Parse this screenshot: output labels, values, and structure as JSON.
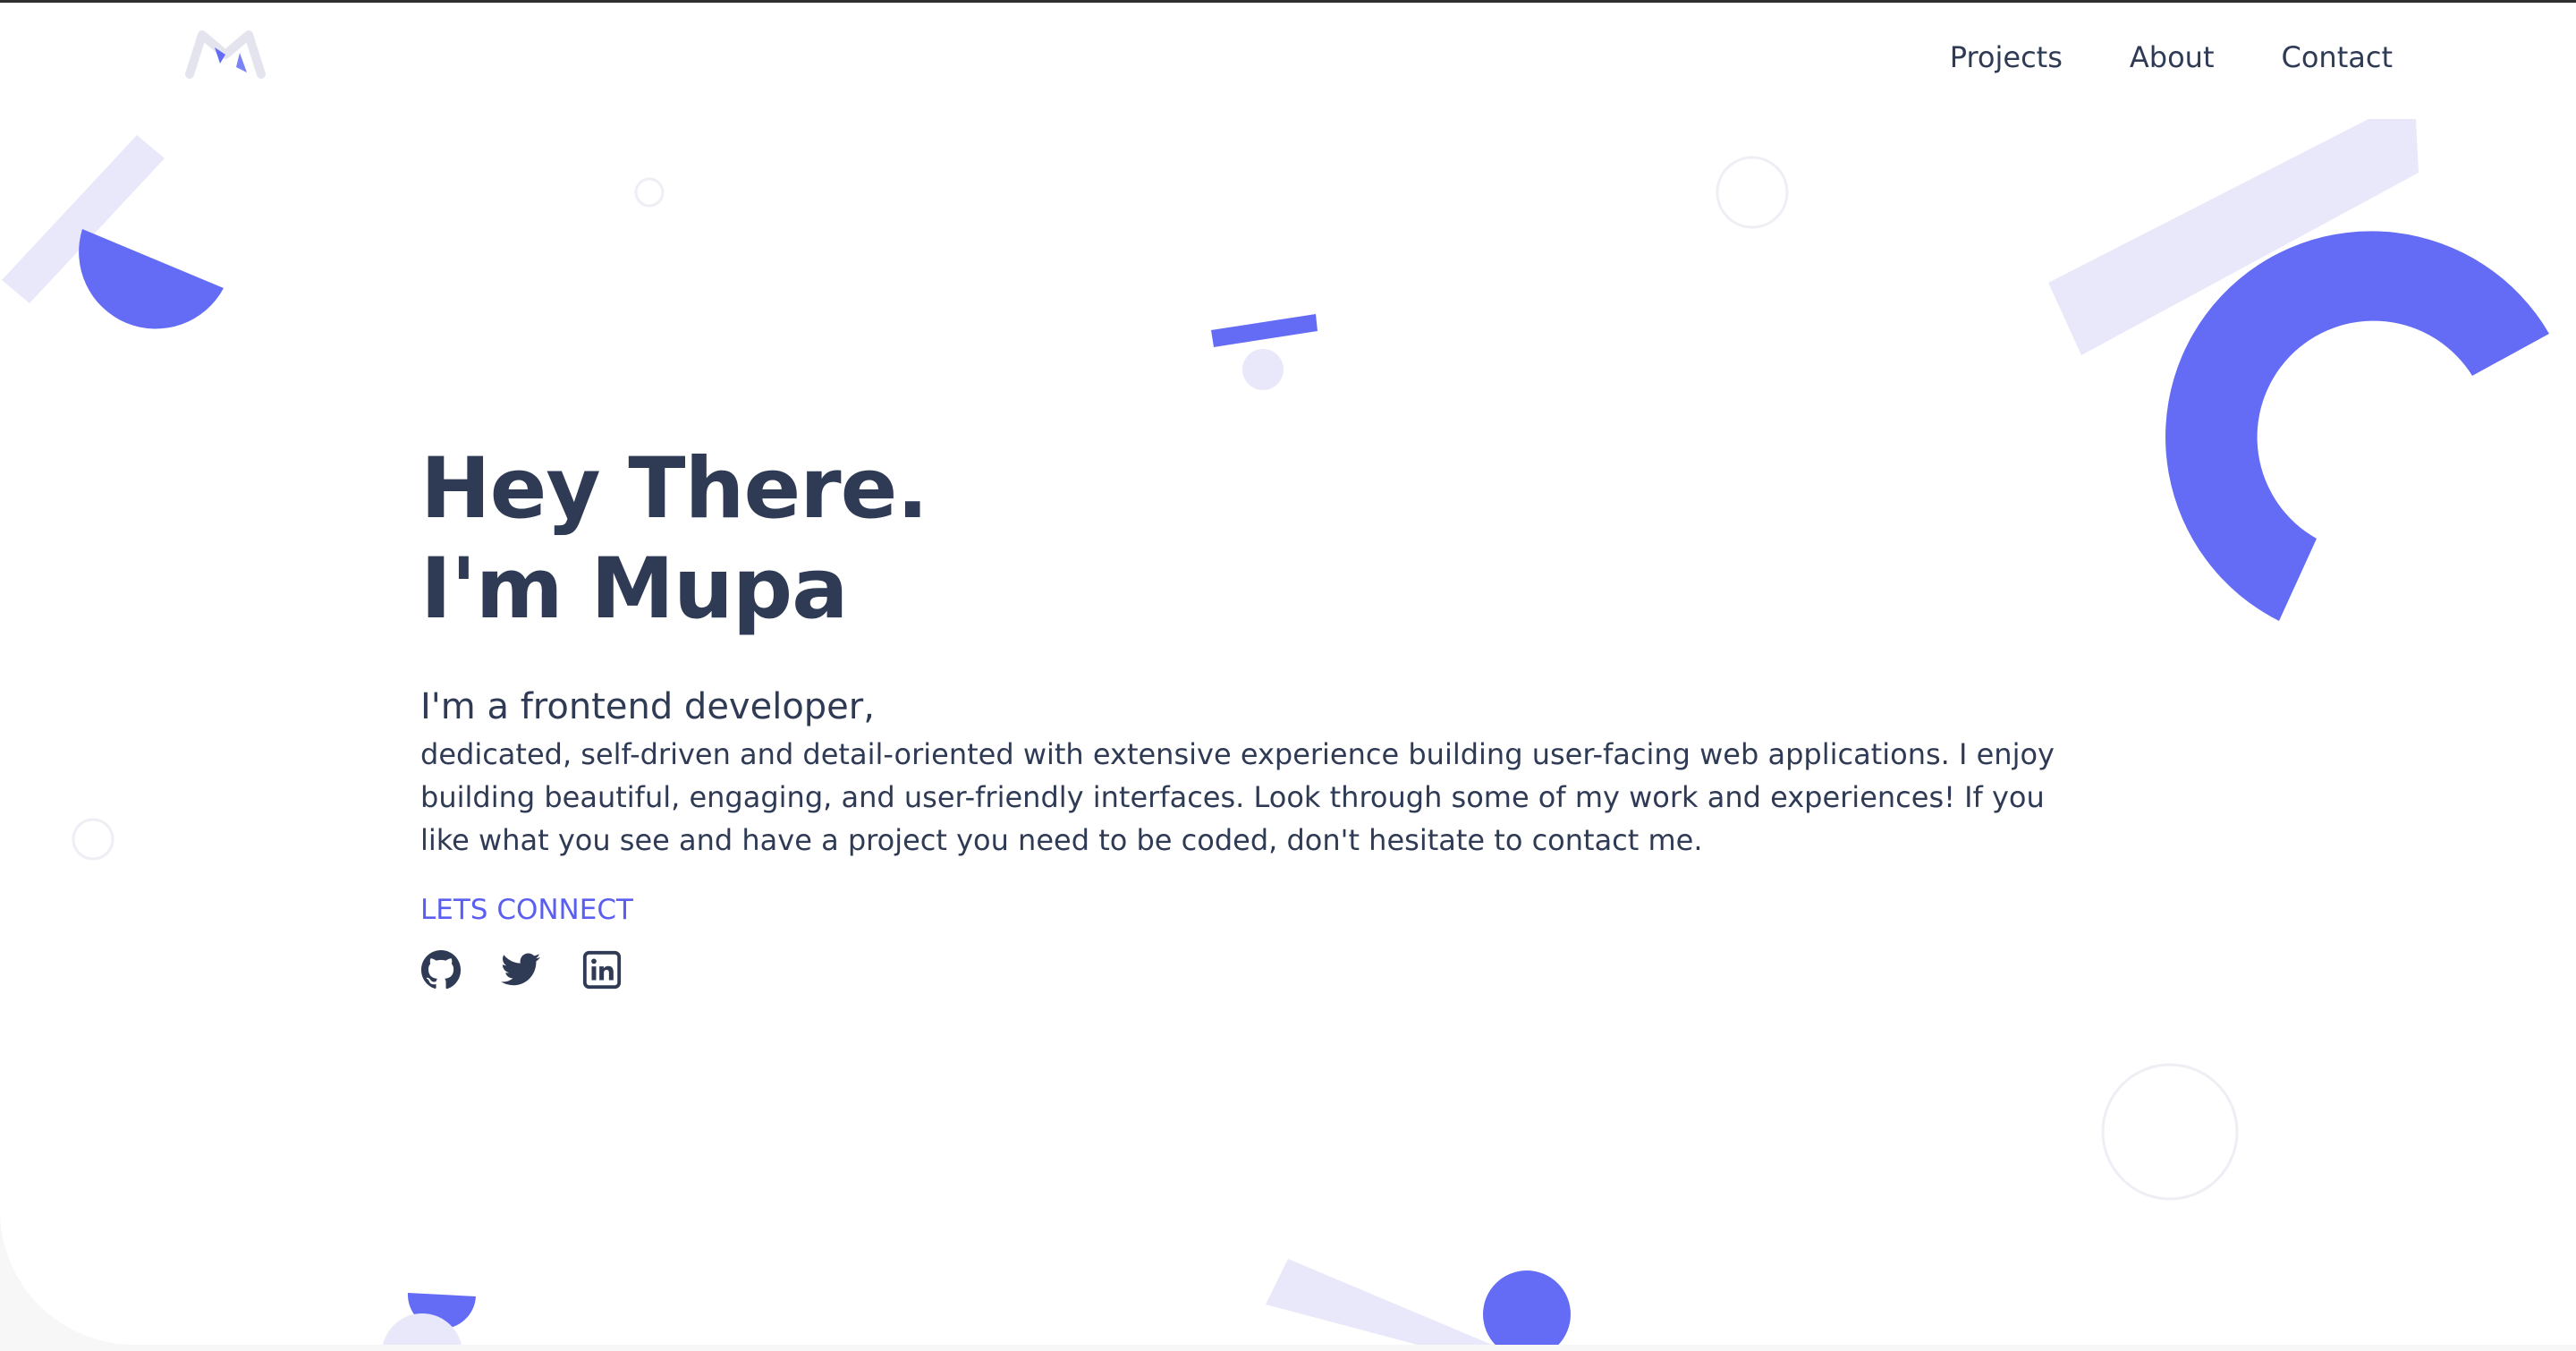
{
  "nav": {
    "items": [
      {
        "label": "Projects"
      },
      {
        "label": "About"
      },
      {
        "label": "Contact"
      }
    ]
  },
  "hero": {
    "title_line_1": "Hey There.",
    "title_line_2": "I'm Mupa",
    "subheading": "I'm a frontend developer,",
    "bio": "dedicated, self-driven and detail-oriented with extensive experience building user-facing web applications. I enjoy building beautiful, engaging, and user-friendly interfaces. Look through some of my work and experiences! If you like what you see and have a project you need to be coded, don't hesitate to contact me.",
    "cta_label": "LETS CONNECT"
  },
  "socials": [
    {
      "icon": "github-icon"
    },
    {
      "icon": "twitter-icon"
    },
    {
      "icon": "linkedin-icon"
    }
  ],
  "colors": {
    "accent": "#646cf5",
    "accent_light": "#e9e8fa",
    "text": "#2f3a55",
    "link": "#5b5ff0"
  }
}
